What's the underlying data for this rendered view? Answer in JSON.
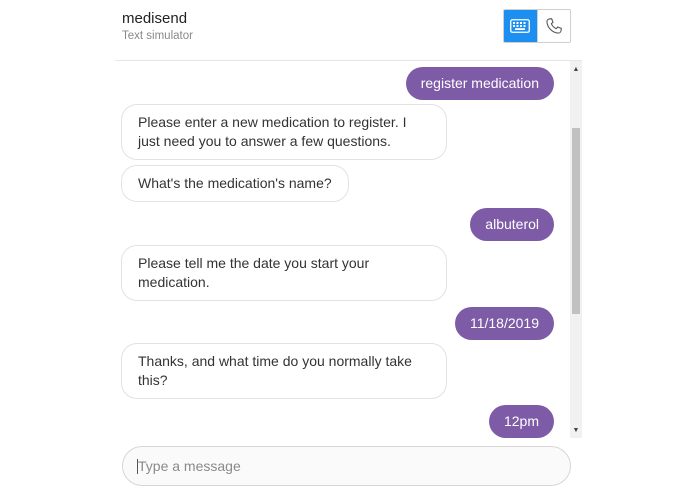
{
  "header": {
    "title": "medisend",
    "subtitle": "Text simulator",
    "modes": [
      {
        "name": "keyboard-icon",
        "active": true
      },
      {
        "name": "phone-icon",
        "active": false
      }
    ]
  },
  "messages": [
    {
      "from": "user",
      "text": "register medication"
    },
    {
      "from": "bot",
      "text": "Please enter a new medication to register. I just need you to answer a few questions."
    },
    {
      "from": "bot",
      "text": "What's the medication's name?"
    },
    {
      "from": "user",
      "text": "albuterol"
    },
    {
      "from": "bot",
      "text": "Please tell me the date you start your medication."
    },
    {
      "from": "user",
      "text": "11/18/2019"
    },
    {
      "from": "bot",
      "text": "Thanks, and what time do you normally take this?"
    },
    {
      "from": "user",
      "text": "12pm"
    }
  ],
  "composer": {
    "placeholder": "Type a message",
    "value": ""
  },
  "colors": {
    "user_bubble": "#7d5ba6",
    "active_toggle": "#1c8ff0"
  }
}
